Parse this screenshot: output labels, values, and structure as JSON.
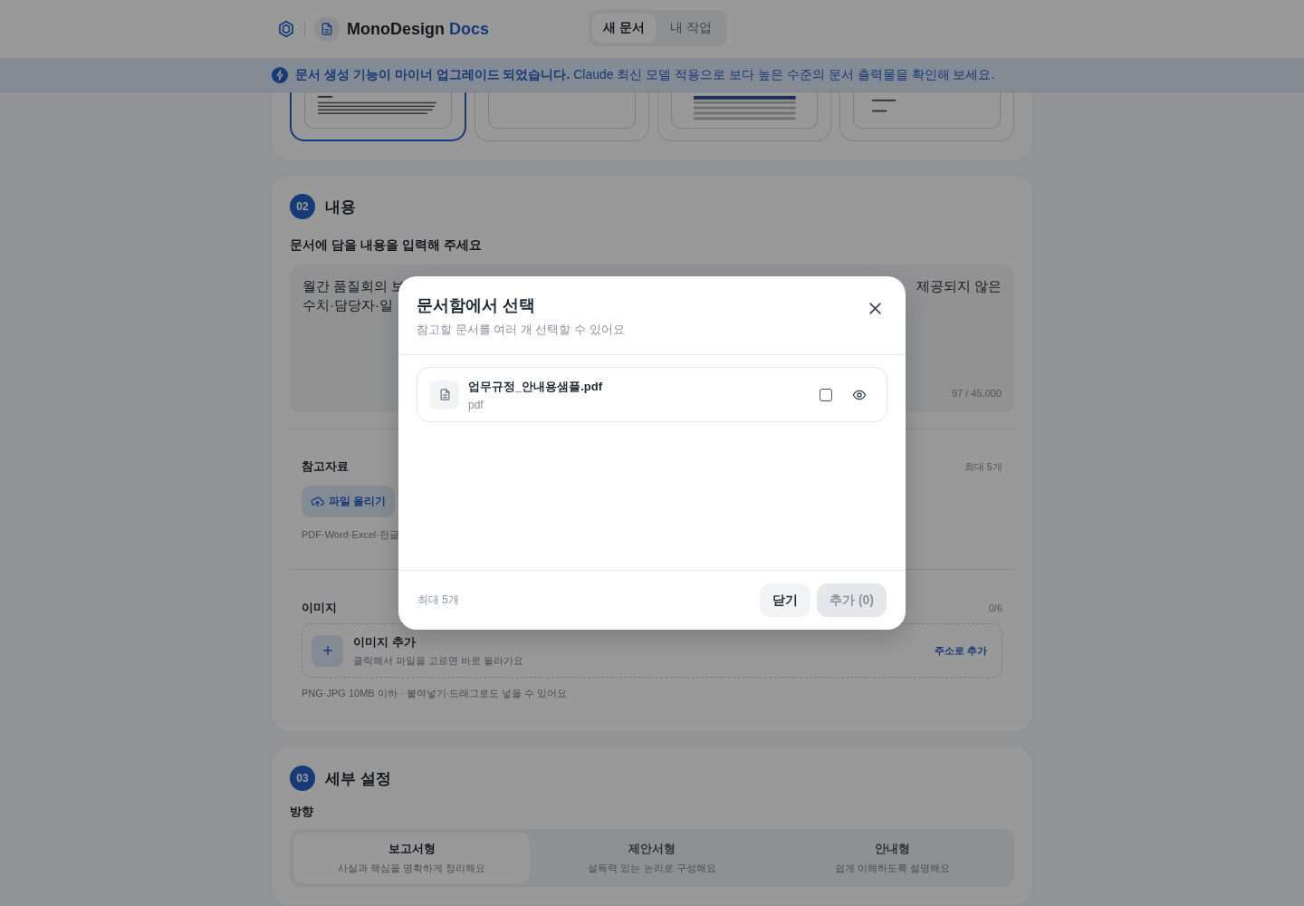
{
  "header": {
    "brand": "MonoDesign",
    "brand_accent": "Docs",
    "tabs": [
      {
        "label": "새 문서",
        "selected": true
      },
      {
        "label": "내 작업",
        "selected": false
      }
    ]
  },
  "banner": {
    "text": "**문서 생성 기능이 마이너 업그레이드 되었습니다.** Claude 최신 모델 적용으로 보다 높은 수준의 문서 출력물을 확인해 보세요."
  },
  "templates": [
    {
      "selected": true
    },
    {
      "selected": false
    },
    {
      "selected": false
    },
    {
      "selected": false
    }
  ],
  "content_section": {
    "number": "02",
    "title": "내용",
    "prompt_label": "문서에 담을 내용을 입력해 주세요",
    "textarea": {
      "lines": [
        {
          "left": "월간 품질회의 보",
          "right": "제공되지 않은"
        },
        {
          "left": "수치·담당자·일"
        }
      ],
      "counter": "97 / 45,000"
    },
    "references": {
      "title": "참고자료",
      "limit": "최대 5개",
      "upload_button": "파일 올리기",
      "hint": "PDF·Word·Excel·한글"
    },
    "images": {
      "title": "이미지",
      "count": "0/6",
      "add_title": "이미지 추가",
      "add_subtitle": "클릭해서 파일을 고르면 바로 올라가요",
      "url_link": "주소로 추가",
      "hint": "PNG·JPG 10MB 이하 · 붙여넣기·드래그로도 넣을 수 있어요"
    }
  },
  "settings_section": {
    "number": "03",
    "title": "세부 설정",
    "direction_label": "방향",
    "options": [
      {
        "title": "보고서형",
        "subtitle": "사실과 핵심을 명확하게 정리해요",
        "selected": true
      },
      {
        "title": "제안서형",
        "subtitle": "설득력 있는 논리로 구성해요",
        "selected": false
      },
      {
        "title": "안내형",
        "subtitle": "쉽게 이해하도록 설명해요",
        "selected": false
      }
    ]
  },
  "modal": {
    "title": "문서함에서 선택",
    "subtitle": "참고할 문서를 여러 개 선택할 수 있어요",
    "files": [
      {
        "name": "업무규정_안내용샘플.pdf",
        "type": "pdf",
        "checked": false
      }
    ],
    "footer_note": "최대 5개",
    "buttons": [
      {
        "label": "닫기",
        "kind": "secondary",
        "disabled": false
      },
      {
        "label": "추가 (0)",
        "kind": "primary",
        "disabled": true
      }
    ]
  }
}
